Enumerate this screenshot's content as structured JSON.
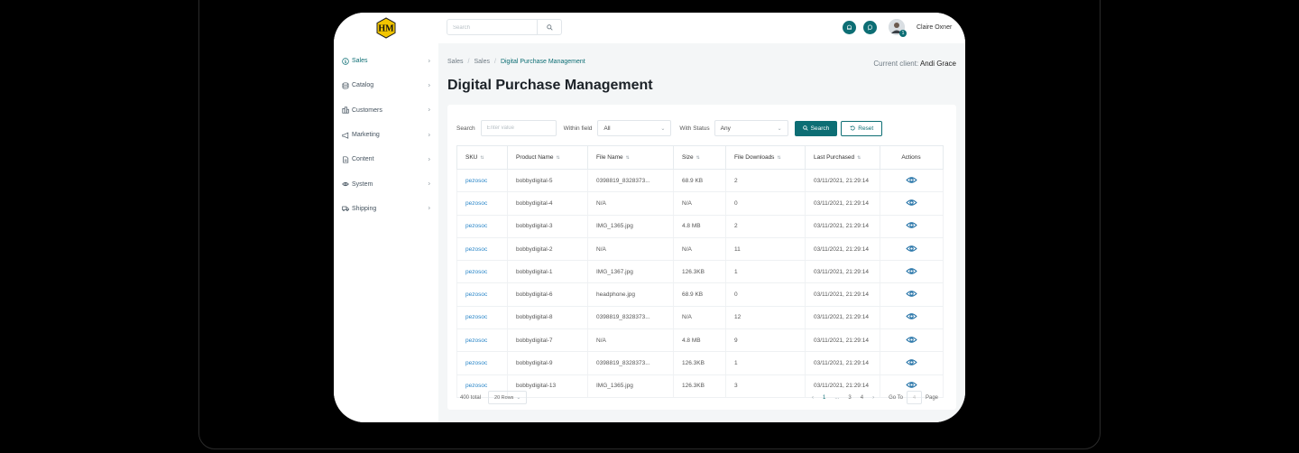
{
  "brand": {
    "logo_text": "HM",
    "accent": "#0d6e74",
    "logo_color": "#f2c500"
  },
  "sidebar": {
    "items": [
      {
        "label": "Sales",
        "icon": "dollar-circle-icon",
        "active": true
      },
      {
        "label": "Catalog",
        "icon": "database-icon"
      },
      {
        "label": "Customers",
        "icon": "building-icon"
      },
      {
        "label": "Marketing",
        "icon": "megaphone-icon"
      },
      {
        "label": "Content",
        "icon": "document-icon"
      },
      {
        "label": "System",
        "icon": "eye-icon"
      },
      {
        "label": "Shipping",
        "icon": "truck-icon"
      }
    ]
  },
  "topbar": {
    "search_placeholder": "Search",
    "user_name": "Claire Oxner",
    "notification_count": "1"
  },
  "breadcrumb": [
    "Sales",
    "Sales",
    "Digital Purchase Management"
  ],
  "client": {
    "label": "Current client:",
    "name": "Andi Grace"
  },
  "page_title": "Digital Purchase Management",
  "filters": {
    "search_label": "Search",
    "search_placeholder": "Enter value",
    "field_label": "Within field",
    "field_value": "All",
    "status_label": "With Status",
    "status_value": "Any",
    "search_button": "Search",
    "reset_button": "Reset"
  },
  "table": {
    "columns": [
      "SKU",
      "Product Name",
      "File Name",
      "Size",
      "File Downloads",
      "Last Purchased",
      "Actions"
    ],
    "rows": [
      {
        "sku": "pezosoc",
        "product": "bobbydigital-5",
        "file": "0398819_8328373...",
        "size": "68.9 KB",
        "downloads": "2",
        "date": "03/11/2021, 21:29:14"
      },
      {
        "sku": "pezosoc",
        "product": "bobbydigital-4",
        "file": "N/A",
        "size": "N/A",
        "downloads": "0",
        "date": "03/11/2021, 21:29:14"
      },
      {
        "sku": "pezosoc",
        "product": "bobbydigital-3",
        "file": "IMG_1365.jpg",
        "size": "4.8 MB",
        "downloads": "2",
        "date": "03/11/2021, 21:29:14"
      },
      {
        "sku": "pezosoc",
        "product": "bobbydigital-2",
        "file": "N/A",
        "size": "N/A",
        "downloads": "11",
        "date": "03/11/2021, 21:29:14"
      },
      {
        "sku": "pezosoc",
        "product": "bobbydigital-1",
        "file": "IMG_1367.jpg",
        "size": "126.3KB",
        "downloads": "1",
        "date": "03/11/2021, 21:29:14"
      },
      {
        "sku": "pezosoc",
        "product": "bobbydigital-6",
        "file": "headphone.jpg",
        "size": "68.9 KB",
        "downloads": "0",
        "date": "03/11/2021, 21:29:14"
      },
      {
        "sku": "pezosoc",
        "product": "bobbydigital-8",
        "file": "0398819_8328373...",
        "size": "N/A",
        "downloads": "12",
        "date": "03/11/2021, 21:29:14"
      },
      {
        "sku": "pezosoc",
        "product": "bobbydigital-7",
        "file": "N/A",
        "size": "4.8 MB",
        "downloads": "9",
        "date": "03/11/2021, 21:29:14"
      },
      {
        "sku": "pezosoc",
        "product": "bobbydigital-9",
        "file": "0398819_8328373...",
        "size": "126.3KB",
        "downloads": "1",
        "date": "03/11/2021, 21:29:14"
      },
      {
        "sku": "pezosoc",
        "product": "bobbydigital-13",
        "file": "IMG_1365.jpg",
        "size": "126.3KB",
        "downloads": "3",
        "date": "03/11/2021, 21:29:14"
      }
    ]
  },
  "pagination": {
    "total": "400 total",
    "rows_per_page": "20 Rows",
    "pages": [
      "1",
      "...",
      "3",
      "4"
    ],
    "goto_label": "Go To",
    "goto_value": "4",
    "page_label": "Page"
  }
}
